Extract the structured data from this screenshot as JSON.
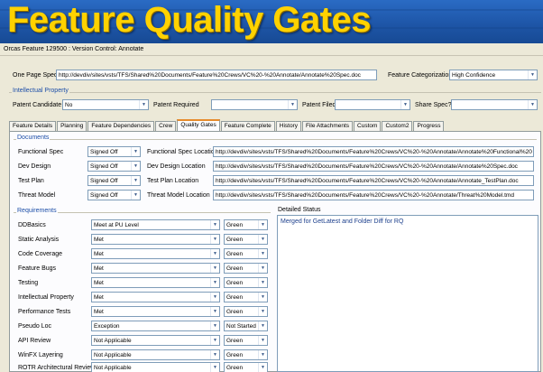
{
  "banner": {
    "title": "Feature Quality Gates"
  },
  "window": {
    "title": "Orcas Feature 129500 : Version Control: Annotate"
  },
  "spec": {
    "label": "One Page Spec",
    "value": "http://devdiv/sites/vsts/TFS/Shared%20Documents/Feature%20Crews/VC%20-%20Annotate/Annotate%20Spec.doc",
    "categorization_label": "Feature Categorization",
    "categorization_value": "High Confidence"
  },
  "ip": {
    "title": "Intellectual Property",
    "patent_candidate_label": "Patent Candidate",
    "patent_candidate_value": "No",
    "patent_required_label": "Patent Required",
    "patent_required_value": "",
    "patent_filed_label": "Patent Filed",
    "patent_filed_value": "",
    "share_spec_label": "Share Spec?",
    "share_spec_value": ""
  },
  "tabs": [
    {
      "label": "Feature Details"
    },
    {
      "label": "Planning"
    },
    {
      "label": "Feature Dependencies"
    },
    {
      "label": "Crew"
    },
    {
      "label": "Quality Gates"
    },
    {
      "label": "Feature Complete"
    },
    {
      "label": "History"
    },
    {
      "label": "File Attachments"
    },
    {
      "label": "Custom"
    },
    {
      "label": "Custom2"
    },
    {
      "label": "Progress"
    }
  ],
  "documents": {
    "title": "Documents",
    "rows": [
      {
        "label": "Functional Spec",
        "status": "Signed Off",
        "loc_label": "Functional Spec Location",
        "loc": "http://devdiv/sites/vsts/TFS/Shared%20Documents/Feature%20Crews/VC%20-%20Annotate/Annotate%20Functional%20"
      },
      {
        "label": "Dev Design",
        "status": "Signed Off",
        "loc_label": "Dev Design Location",
        "loc": "http://devdiv/sites/vsts/TFS/Shared%20Documents/Feature%20Crews/VC%20-%20Annotate/Annotate%20Spec.doc"
      },
      {
        "label": "Test Plan",
        "status": "Signed Off",
        "loc_label": "Test Plan Location",
        "loc": "http://devdiv/sites/vsts/TFS/Shared%20Documents/Feature%20Crews/VC%20-%20Annotate/Annotate_TestPlan.doc"
      },
      {
        "label": "Threat Model",
        "status": "Signed Off",
        "loc_label": "Threat Model Location",
        "loc": "http://devdiv/sites/vsts/TFS/Shared%20Documents/Feature%20Crews/VC%20-%20Annotate/Threat%20Model.tmd"
      }
    ]
  },
  "requirements": {
    "title": "Requirements",
    "rows": [
      {
        "label": "DDBasics",
        "value": "Meet at PU Level",
        "color": "Green"
      },
      {
        "label": "Static Analysis",
        "value": "Met",
        "color": "Green"
      },
      {
        "label": "Code Coverage",
        "value": "Met",
        "color": "Green"
      },
      {
        "label": "Feature Bugs",
        "value": "Met",
        "color": "Green"
      },
      {
        "label": "Testing",
        "value": "Met",
        "color": "Green"
      },
      {
        "label": "Intellectual Property",
        "value": "Met",
        "color": "Green"
      },
      {
        "label": "Performance Tests",
        "value": "Met",
        "color": "Green"
      },
      {
        "label": "Pseudo Loc",
        "value": "Exception",
        "color": "Not Started"
      },
      {
        "label": "API Review",
        "value": "Not Applicable",
        "color": "Green"
      },
      {
        "label": "WinFX Layering",
        "value": "Not Applicable",
        "color": "Green"
      },
      {
        "label": "ROTR Architectural Review",
        "value": "Not Applicable",
        "color": "Green"
      }
    ]
  },
  "detailed_status": {
    "label": "Detailed Status",
    "text": "Merged for GetLatest and Folder Diff for RQ"
  },
  "colors": {
    "banner": "#1e56a8",
    "banner_text": "#ffd200",
    "group_title": "#1c4ea8",
    "active_tab_accent": "#e68b2c"
  }
}
